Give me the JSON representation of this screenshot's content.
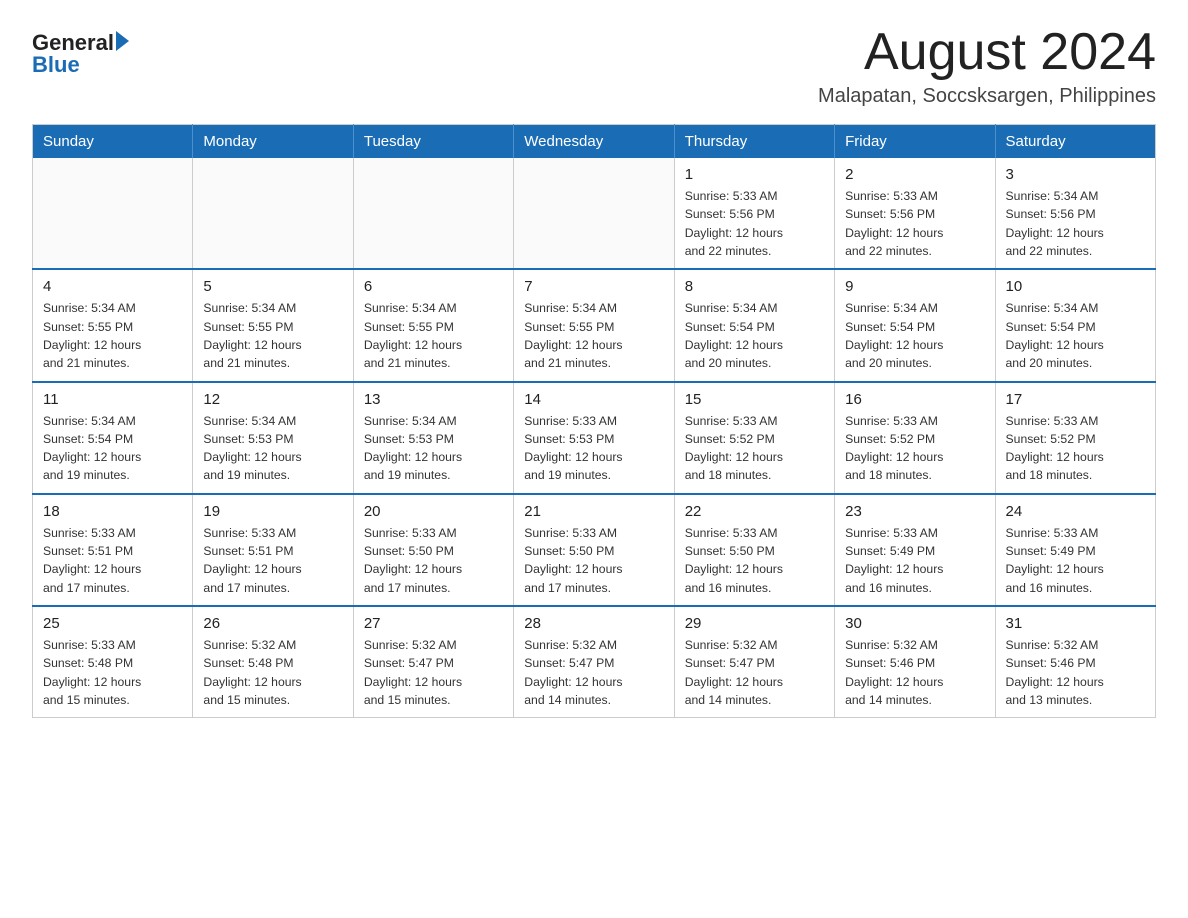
{
  "header": {
    "logo_general": "General",
    "logo_blue": "Blue",
    "month_title": "August 2024",
    "location": "Malapatan, Soccsksargen, Philippines"
  },
  "weekdays": [
    "Sunday",
    "Monday",
    "Tuesday",
    "Wednesday",
    "Thursday",
    "Friday",
    "Saturday"
  ],
  "weeks": [
    [
      {
        "day": "",
        "info": ""
      },
      {
        "day": "",
        "info": ""
      },
      {
        "day": "",
        "info": ""
      },
      {
        "day": "",
        "info": ""
      },
      {
        "day": "1",
        "info": "Sunrise: 5:33 AM\nSunset: 5:56 PM\nDaylight: 12 hours\nand 22 minutes."
      },
      {
        "day": "2",
        "info": "Sunrise: 5:33 AM\nSunset: 5:56 PM\nDaylight: 12 hours\nand 22 minutes."
      },
      {
        "day": "3",
        "info": "Sunrise: 5:34 AM\nSunset: 5:56 PM\nDaylight: 12 hours\nand 22 minutes."
      }
    ],
    [
      {
        "day": "4",
        "info": "Sunrise: 5:34 AM\nSunset: 5:55 PM\nDaylight: 12 hours\nand 21 minutes."
      },
      {
        "day": "5",
        "info": "Sunrise: 5:34 AM\nSunset: 5:55 PM\nDaylight: 12 hours\nand 21 minutes."
      },
      {
        "day": "6",
        "info": "Sunrise: 5:34 AM\nSunset: 5:55 PM\nDaylight: 12 hours\nand 21 minutes."
      },
      {
        "day": "7",
        "info": "Sunrise: 5:34 AM\nSunset: 5:55 PM\nDaylight: 12 hours\nand 21 minutes."
      },
      {
        "day": "8",
        "info": "Sunrise: 5:34 AM\nSunset: 5:54 PM\nDaylight: 12 hours\nand 20 minutes."
      },
      {
        "day": "9",
        "info": "Sunrise: 5:34 AM\nSunset: 5:54 PM\nDaylight: 12 hours\nand 20 minutes."
      },
      {
        "day": "10",
        "info": "Sunrise: 5:34 AM\nSunset: 5:54 PM\nDaylight: 12 hours\nand 20 minutes."
      }
    ],
    [
      {
        "day": "11",
        "info": "Sunrise: 5:34 AM\nSunset: 5:54 PM\nDaylight: 12 hours\nand 19 minutes."
      },
      {
        "day": "12",
        "info": "Sunrise: 5:34 AM\nSunset: 5:53 PM\nDaylight: 12 hours\nand 19 minutes."
      },
      {
        "day": "13",
        "info": "Sunrise: 5:34 AM\nSunset: 5:53 PM\nDaylight: 12 hours\nand 19 minutes."
      },
      {
        "day": "14",
        "info": "Sunrise: 5:33 AM\nSunset: 5:53 PM\nDaylight: 12 hours\nand 19 minutes."
      },
      {
        "day": "15",
        "info": "Sunrise: 5:33 AM\nSunset: 5:52 PM\nDaylight: 12 hours\nand 18 minutes."
      },
      {
        "day": "16",
        "info": "Sunrise: 5:33 AM\nSunset: 5:52 PM\nDaylight: 12 hours\nand 18 minutes."
      },
      {
        "day": "17",
        "info": "Sunrise: 5:33 AM\nSunset: 5:52 PM\nDaylight: 12 hours\nand 18 minutes."
      }
    ],
    [
      {
        "day": "18",
        "info": "Sunrise: 5:33 AM\nSunset: 5:51 PM\nDaylight: 12 hours\nand 17 minutes."
      },
      {
        "day": "19",
        "info": "Sunrise: 5:33 AM\nSunset: 5:51 PM\nDaylight: 12 hours\nand 17 minutes."
      },
      {
        "day": "20",
        "info": "Sunrise: 5:33 AM\nSunset: 5:50 PM\nDaylight: 12 hours\nand 17 minutes."
      },
      {
        "day": "21",
        "info": "Sunrise: 5:33 AM\nSunset: 5:50 PM\nDaylight: 12 hours\nand 17 minutes."
      },
      {
        "day": "22",
        "info": "Sunrise: 5:33 AM\nSunset: 5:50 PM\nDaylight: 12 hours\nand 16 minutes."
      },
      {
        "day": "23",
        "info": "Sunrise: 5:33 AM\nSunset: 5:49 PM\nDaylight: 12 hours\nand 16 minutes."
      },
      {
        "day": "24",
        "info": "Sunrise: 5:33 AM\nSunset: 5:49 PM\nDaylight: 12 hours\nand 16 minutes."
      }
    ],
    [
      {
        "day": "25",
        "info": "Sunrise: 5:33 AM\nSunset: 5:48 PM\nDaylight: 12 hours\nand 15 minutes."
      },
      {
        "day": "26",
        "info": "Sunrise: 5:32 AM\nSunset: 5:48 PM\nDaylight: 12 hours\nand 15 minutes."
      },
      {
        "day": "27",
        "info": "Sunrise: 5:32 AM\nSunset: 5:47 PM\nDaylight: 12 hours\nand 15 minutes."
      },
      {
        "day": "28",
        "info": "Sunrise: 5:32 AM\nSunset: 5:47 PM\nDaylight: 12 hours\nand 14 minutes."
      },
      {
        "day": "29",
        "info": "Sunrise: 5:32 AM\nSunset: 5:47 PM\nDaylight: 12 hours\nand 14 minutes."
      },
      {
        "day": "30",
        "info": "Sunrise: 5:32 AM\nSunset: 5:46 PM\nDaylight: 12 hours\nand 14 minutes."
      },
      {
        "day": "31",
        "info": "Sunrise: 5:32 AM\nSunset: 5:46 PM\nDaylight: 12 hours\nand 13 minutes."
      }
    ]
  ]
}
